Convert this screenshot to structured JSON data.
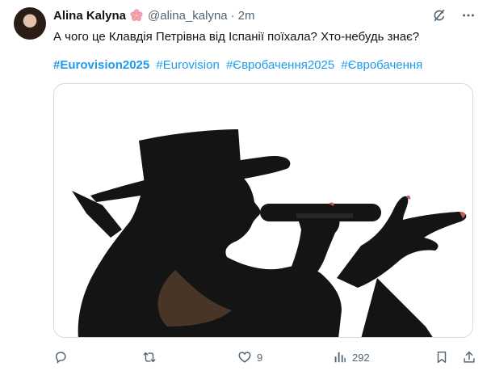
{
  "tweet": {
    "author_name": "Alina Kalyna",
    "author_handle": "@alina_kalyna",
    "separator": "·",
    "time": "2m",
    "text": "А чого це Клавдія Петрівна від Іспанії поїхала? Хто-небудь знає?",
    "hashtags": [
      "#Eurovision2025",
      "#Eurovision",
      "#Євробачення2025",
      "#Євробачення"
    ],
    "badge_icon": "cherry-blossom-icon",
    "media_icon": "silhouette-with-hat-and-microphone"
  },
  "actions": {
    "reply": {
      "icon": "reply-icon",
      "count": ""
    },
    "retweet": {
      "icon": "retweet-icon",
      "count": ""
    },
    "like": {
      "icon": "heart-icon",
      "count": "9"
    },
    "views": {
      "icon": "views-icon",
      "count": "292"
    },
    "bookmark": {
      "icon": "bookmark-icon"
    },
    "share": {
      "icon": "share-icon"
    }
  },
  "colors": {
    "hashtag": "#1d9bf0",
    "muted": "#536471",
    "text": "#0f1419",
    "border": "#cfd9de"
  }
}
